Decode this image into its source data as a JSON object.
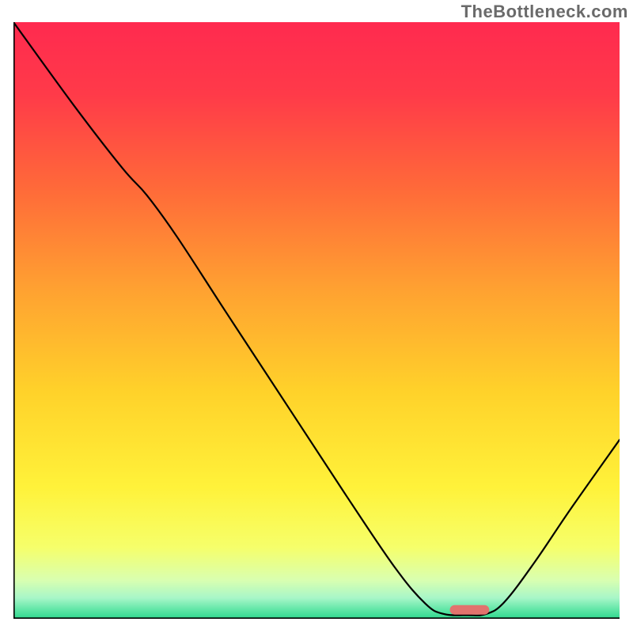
{
  "domain": "Chart",
  "watermark": "TheBottleneck.com",
  "chart_data": {
    "type": "line",
    "title": "",
    "xlabel": "",
    "ylabel": "",
    "xlim": [
      0,
      100
    ],
    "ylim": [
      0,
      100
    ],
    "gradient_stops": [
      {
        "offset": 0.0,
        "color": "#ff2a4f"
      },
      {
        "offset": 0.12,
        "color": "#ff3a49"
      },
      {
        "offset": 0.28,
        "color": "#ff6a39"
      },
      {
        "offset": 0.45,
        "color": "#ffa231"
      },
      {
        "offset": 0.62,
        "color": "#ffd22a"
      },
      {
        "offset": 0.78,
        "color": "#fff23a"
      },
      {
        "offset": 0.88,
        "color": "#f6ff6a"
      },
      {
        "offset": 0.935,
        "color": "#d9ffb0"
      },
      {
        "offset": 0.965,
        "color": "#a8f6c8"
      },
      {
        "offset": 0.985,
        "color": "#5fe6a6"
      },
      {
        "offset": 1.0,
        "color": "#2fd88e"
      }
    ],
    "curve": [
      {
        "x": 0.0,
        "y": 100.0
      },
      {
        "x": 10.0,
        "y": 86.0
      },
      {
        "x": 18.0,
        "y": 75.5
      },
      {
        "x": 22.0,
        "y": 71.0
      },
      {
        "x": 27.0,
        "y": 64.0
      },
      {
        "x": 35.0,
        "y": 51.5
      },
      {
        "x": 45.0,
        "y": 36.0
      },
      {
        "x": 55.0,
        "y": 20.5
      },
      {
        "x": 63.0,
        "y": 8.5
      },
      {
        "x": 68.0,
        "y": 2.5
      },
      {
        "x": 71.0,
        "y": 0.8
      },
      {
        "x": 75.0,
        "y": 0.6
      },
      {
        "x": 78.0,
        "y": 0.8
      },
      {
        "x": 81.0,
        "y": 2.8
      },
      {
        "x": 86.0,
        "y": 9.5
      },
      {
        "x": 92.0,
        "y": 18.5
      },
      {
        "x": 100.0,
        "y": 30.0
      }
    ],
    "marker": {
      "x_from": 72.0,
      "x_to": 78.5,
      "y": 1.5,
      "color": "#e2736d"
    }
  }
}
